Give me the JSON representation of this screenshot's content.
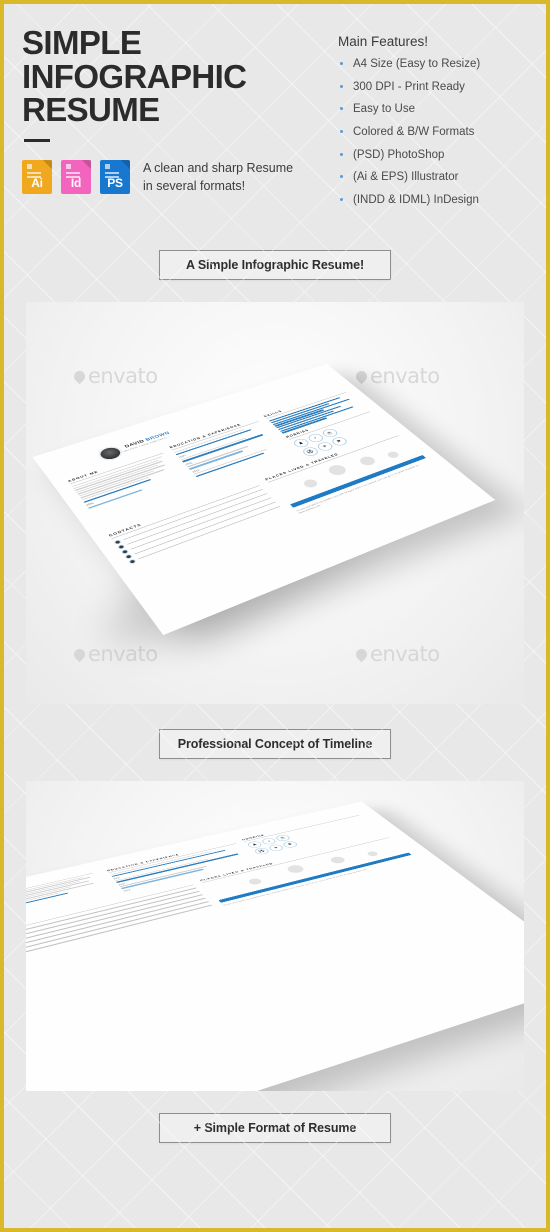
{
  "theme": {
    "frame_color": "#d9b829",
    "background": "#e8e8e8",
    "accent_blue": "#2f7fbf",
    "bullet_blue": "#5b9bd5",
    "ai_color": "#f0a81e",
    "id_color": "#f364be",
    "ps_color": "#1878cf"
  },
  "header": {
    "title_lines": [
      "SIMPLE",
      "INFOGRAPHIC",
      "RESUME"
    ],
    "formats": [
      {
        "label": "Ai",
        "name": "illustrator-file-icon"
      },
      {
        "label": "Id",
        "name": "indesign-file-icon"
      },
      {
        "label": "PS",
        "name": "photoshop-file-icon"
      }
    ],
    "caption_line1": "A clean and sharp Resume",
    "caption_line2": "in several formats!"
  },
  "features": {
    "title": "Main Features!",
    "items": [
      "A4 Size (Easy to Resize)",
      "300 DPI - Print Ready",
      "Easy to Use",
      "Colored & B/W Formats",
      "(PSD) PhotoShop",
      "(Ai & EPS) Illustrator",
      "(INDD & IDML) InDesign"
    ]
  },
  "sections": {
    "label_1": "A Simple Infographic Resume!",
    "label_2": "Professional Concept of Timeline",
    "label_3": "+ Simple Format of Resume"
  },
  "watermark": {
    "text": "envato"
  },
  "resume": {
    "name_first": "DAVID",
    "name_last": "BROWN",
    "role": "GRAPHIC / WEB DESIGNER",
    "sections": {
      "about": "ABOUT ME",
      "education": "EDUCATION & EXPERIENCE",
      "skills": "SKILLS",
      "places": "PLACES LIVED & TRAVELED",
      "hobbies": "HOBBIES",
      "contacts": "CONTACTS"
    },
    "years": [
      "2006",
      "2009",
      "2011",
      "2012",
      "2013",
      "2015"
    ],
    "hobby_icons": [
      "♟",
      "♪",
      "☕",
      "⚽",
      "✈",
      "⚑"
    ],
    "footnote": "To see and watch my graphic and web designs which I've created, you can go to my place & profile at www.domain.com"
  }
}
